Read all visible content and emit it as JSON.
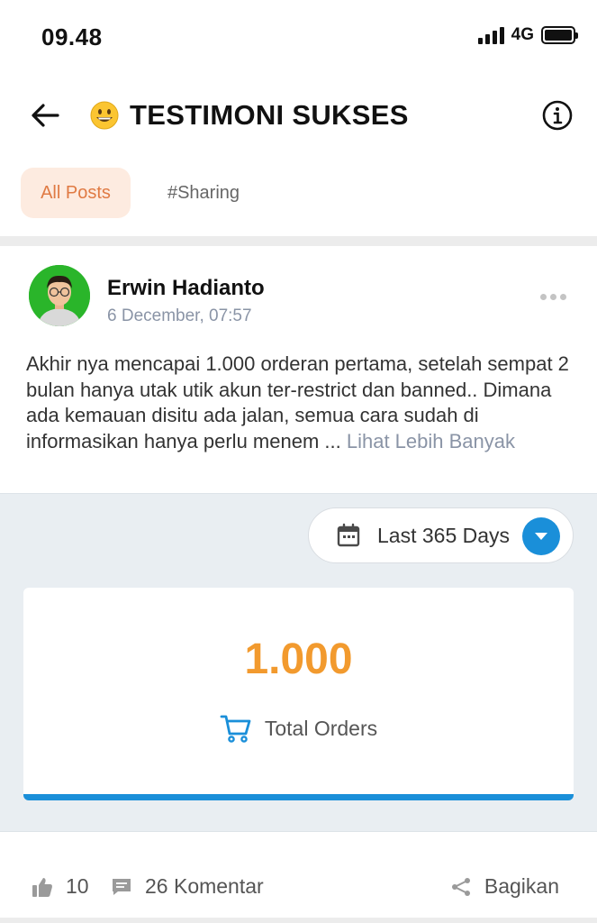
{
  "status_bar": {
    "time": "09.48",
    "network": "4G",
    "signal_icon": "signal-bars-icon",
    "battery_icon": "battery-icon"
  },
  "header": {
    "back_icon": "arrow-left-icon",
    "emoji": "grinning-face-emoji",
    "title": "TESTIMONI SUKSES",
    "info_icon": "info-circle-icon"
  },
  "tabs": [
    {
      "label": "All Posts",
      "active": true
    },
    {
      "label": "#Sharing",
      "active": false
    }
  ],
  "post": {
    "author": "Erwin Hadianto",
    "date": "6 December, 07:57",
    "body": "Akhir nya mencapai 1.000 orderan pertama, setelah sempat 2 bulan hanya utak utik akun ter-restrict dan banned.. Dimana ada kemauan disitu ada jalan, semua cara sudah di informasikan hanya perlu menem ... ",
    "see_more": "Lihat Lebih Banyak"
  },
  "card": {
    "filter_label": "Last 365 Days",
    "calendar_icon": "calendar-icon",
    "dropdown_icon": "chevron-down-icon",
    "value": "1.000",
    "label": "Total Orders",
    "cart_icon": "shopping-cart-icon"
  },
  "actions": {
    "likes": "10",
    "like_icon": "thumbs-up-icon",
    "comments": "26 Komentar",
    "comment_icon": "comment-icon",
    "share": "Bagikan",
    "share_icon": "share-icon"
  },
  "colors": {
    "accent_orange": "#f29a2e",
    "tab_active_bg": "#fdebe0",
    "tab_active_text": "#e07a43",
    "accent_blue": "#1a8fd9",
    "card_area_bg": "#e9eef2"
  }
}
